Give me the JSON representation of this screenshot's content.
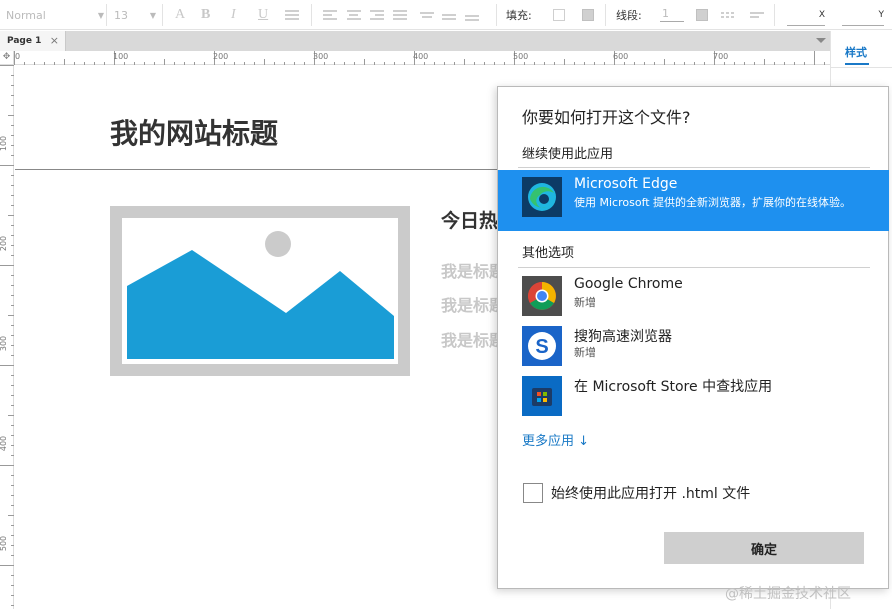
{
  "toolbar": {
    "font_name": "Normal",
    "font_size": "13",
    "fill_label": "填充:",
    "line_label": "线段:",
    "line_width": "1",
    "x_label": "X",
    "y_label": "Y"
  },
  "tabbar": {
    "page_tab": "Page 1",
    "close_glyph": "×"
  },
  "right_panel": {
    "style_tab": "样式"
  },
  "ruler": {
    "h_ticks": [
      "0",
      "100",
      "200",
      "300",
      "400",
      "500",
      "600",
      "700"
    ],
    "v_ticks": [
      "100",
      "200",
      "300",
      "400",
      "500"
    ]
  },
  "canvas": {
    "site_title": "我的网站标题",
    "subheading": "今日热门",
    "para_lines": [
      "我是标题",
      "我是标题",
      "我是标题"
    ]
  },
  "dialog": {
    "question": "你要如何打开这个文件?",
    "continue_section": "继续使用此应用",
    "other_section": "其他选项",
    "apps": [
      {
        "name": "Microsoft Edge",
        "desc": "使用 Microsoft 提供的全新浏览器，扩展你的在线体验。",
        "selected": true,
        "icon": "edge-icon"
      },
      {
        "name": "Google Chrome",
        "desc": "新增",
        "selected": false,
        "icon": "chrome-icon"
      },
      {
        "name": "搜狗高速浏览器",
        "desc": "新增",
        "selected": false,
        "icon": "sogou-icon"
      },
      {
        "name": "在 Microsoft Store 中查找应用",
        "desc": "",
        "selected": false,
        "icon": "store-icon"
      }
    ],
    "more_apps": "更多应用 ↓",
    "always_use": "始终使用此应用打开 .html 文件",
    "ok_button": "确定"
  },
  "watermark": "@稀土掘金技术社区",
  "colors": {
    "accent": "#1e90ef",
    "link": "#1979c6",
    "image_placeholder": "#1a9dd6"
  }
}
